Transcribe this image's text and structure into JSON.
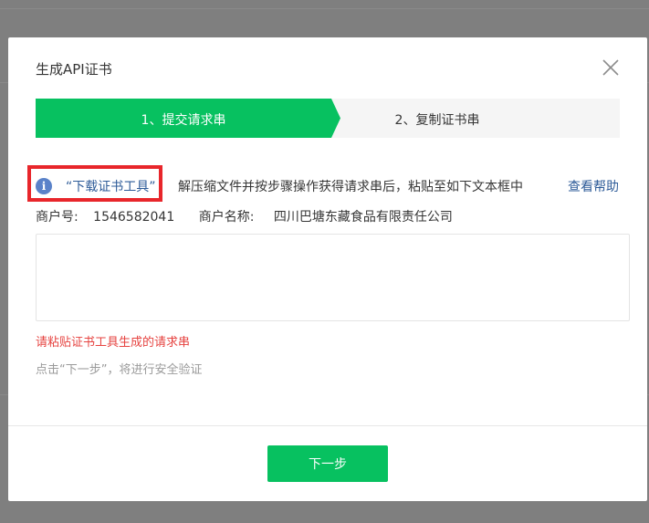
{
  "dialog": {
    "title": "生成API证书",
    "close_icon": "close-icon"
  },
  "steps": [
    {
      "label": "1、提交请求串",
      "active": true
    },
    {
      "label": "2、复制证书串",
      "active": false
    }
  ],
  "info": {
    "icon": "info-icon",
    "icon_glyph": "i",
    "download_link": "“下载证书工具”",
    "instruction": "解压缩文件并按步骤操作获得请求串后，粘贴至如下文本框中",
    "help_link": "查看帮助"
  },
  "merchant": {
    "id_label": "商户号:",
    "id_value": "1546582041",
    "name_label": "商户名称:",
    "name_value": "四川巴塘东藏食品有限责任公司"
  },
  "request_input": {
    "value": "",
    "placeholder": ""
  },
  "error_message": "请粘贴证书工具生成的请求串",
  "hint": "点击“下一步”，将进行安全验证",
  "next_button": "下一步",
  "colors": {
    "accent": "#07c160",
    "link": "#2d5b98",
    "error": "#e64340",
    "highlight_border": "#e8262b"
  }
}
